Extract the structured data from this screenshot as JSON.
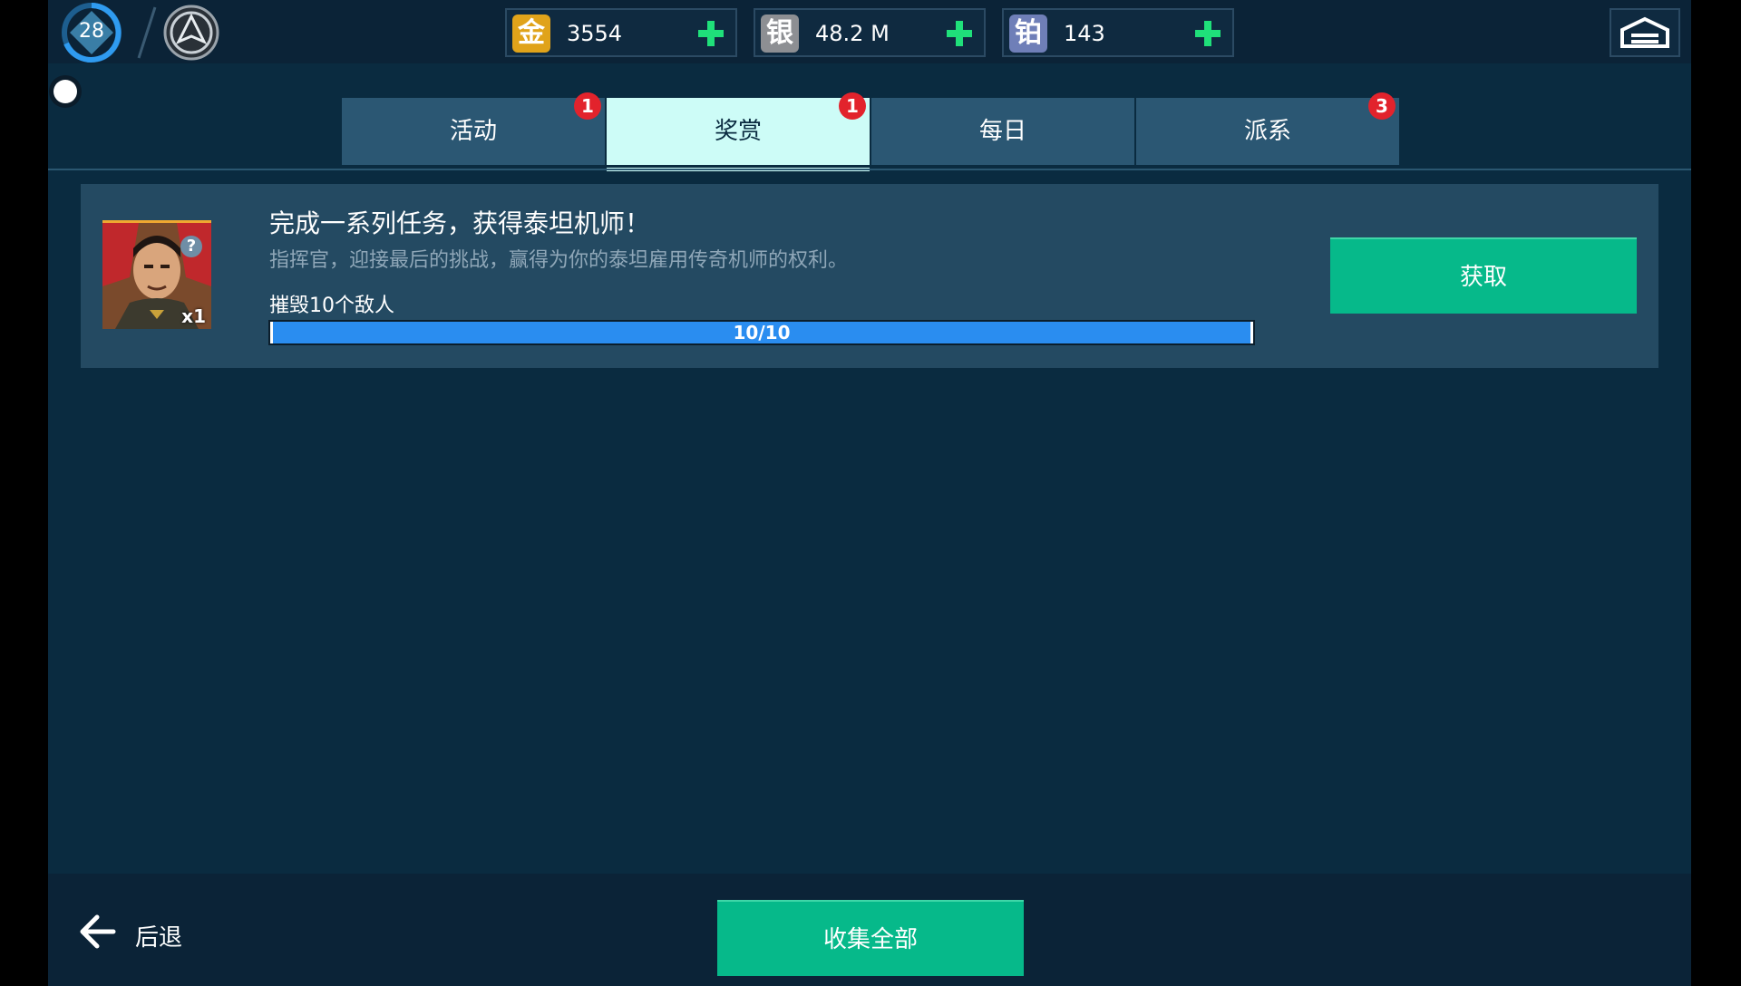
{
  "header": {
    "level": "28",
    "currencies": [
      {
        "icon_char": "金",
        "icon": "gold-icon",
        "value": "3554",
        "color": "#e0a31a"
      },
      {
        "icon_char": "银",
        "icon": "silver-icon",
        "value": "48.2 M",
        "color": "#8d8f93"
      },
      {
        "icon_char": "铂",
        "icon": "platinum-icon",
        "value": "143",
        "color": "#6f7fb8"
      }
    ],
    "plus_color": "#1fe07a"
  },
  "tabs": [
    {
      "label": "活动",
      "badge": "1",
      "active": false
    },
    {
      "label": "奖赏",
      "badge": "1",
      "active": true
    },
    {
      "label": "每日",
      "badge": "",
      "active": false
    },
    {
      "label": "派系",
      "badge": "3",
      "active": false
    }
  ],
  "mission": {
    "title": "完成一系列任务，获得泰坦机师！",
    "description": "指挥官，迎接最后的挑战，赢得为你的泰坦雇用传奇机师的权利。",
    "reward_help": "?",
    "reward_qty": "x1",
    "task": "摧毁10个敌人",
    "progress_text": "10/10",
    "progress_current": 10,
    "progress_total": 10,
    "claim_label": "获取"
  },
  "footer": {
    "back_label": "后退",
    "collect_all_label": "收集全部"
  },
  "colors": {
    "background": "#0a2b40",
    "accent_green": "#06b98a",
    "active_tab": "#cdfcf7",
    "badge_red": "#e2232c",
    "progress_blue": "#2a8df0"
  }
}
